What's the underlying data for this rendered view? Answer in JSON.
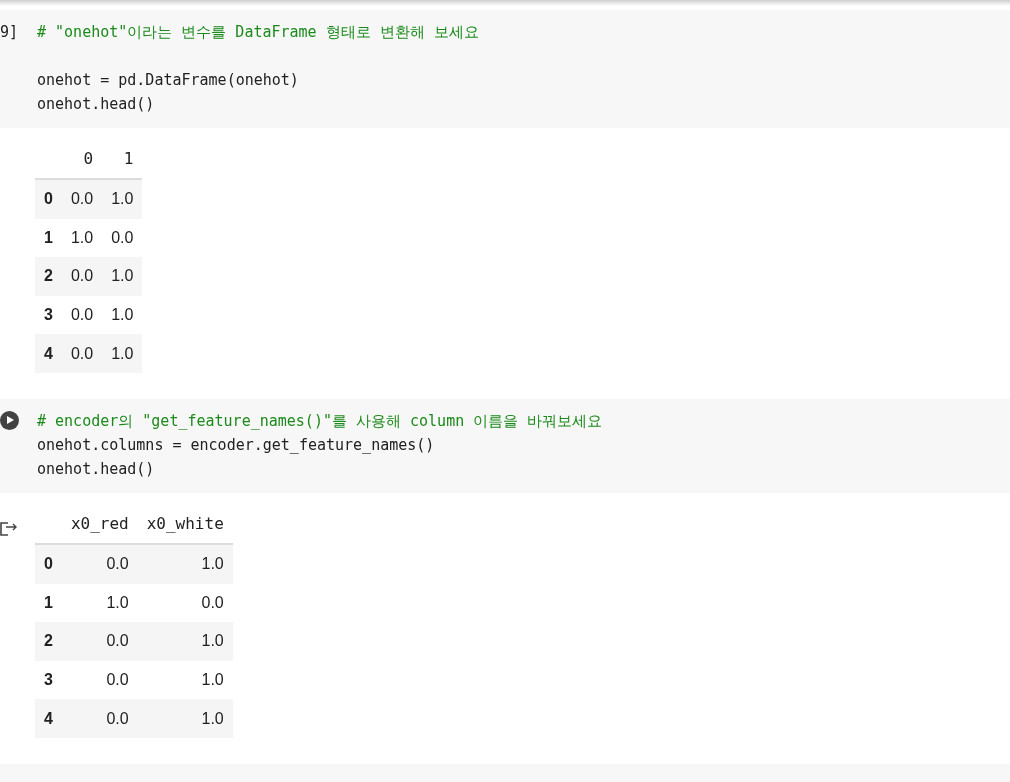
{
  "cells": [
    {
      "kind": "code",
      "gutter": {
        "kind": "count",
        "text": "9]"
      },
      "lines": [
        {
          "kind": "comment",
          "text": "# \"onehot\"이라는 변수를 DataFrame 형태로 변환해 보세요"
        },
        {
          "kind": "blank"
        },
        {
          "kind": "code",
          "text": "onehot = pd.DataFrame(onehot)"
        },
        {
          "kind": "code",
          "text": "onehot.head()"
        }
      ],
      "output": {
        "show_icon": false,
        "table": {
          "columns": [
            "0",
            "1"
          ],
          "rows": [
            {
              "index": "0",
              "values": [
                "0.0",
                "1.0"
              ]
            },
            {
              "index": "1",
              "values": [
                "1.0",
                "0.0"
              ]
            },
            {
              "index": "2",
              "values": [
                "0.0",
                "1.0"
              ]
            },
            {
              "index": "3",
              "values": [
                "0.0",
                "1.0"
              ]
            },
            {
              "index": "4",
              "values": [
                "0.0",
                "1.0"
              ]
            }
          ]
        }
      }
    },
    {
      "kind": "code",
      "gutter": {
        "kind": "run_button"
      },
      "lines": [
        {
          "kind": "comment",
          "text": "# encoder의 \"get_feature_names()\"를 사용해 column 이름을 바꿔보세요"
        },
        {
          "kind": "code",
          "text": "onehot.columns = encoder.get_feature_names()"
        },
        {
          "kind": "code",
          "text": "onehot.head()"
        }
      ],
      "output": {
        "show_icon": true,
        "table": {
          "columns": [
            "x0_red",
            "x0_white"
          ],
          "rows": [
            {
              "index": "0",
              "values": [
                "0.0",
                "1.0"
              ]
            },
            {
              "index": "1",
              "values": [
                "1.0",
                "0.0"
              ]
            },
            {
              "index": "2",
              "values": [
                "0.0",
                "1.0"
              ]
            },
            {
              "index": "3",
              "values": [
                "0.0",
                "1.0"
              ]
            },
            {
              "index": "4",
              "values": [
                "0.0",
                "1.0"
              ]
            }
          ]
        }
      }
    },
    {
      "kind": "code"
    }
  ]
}
